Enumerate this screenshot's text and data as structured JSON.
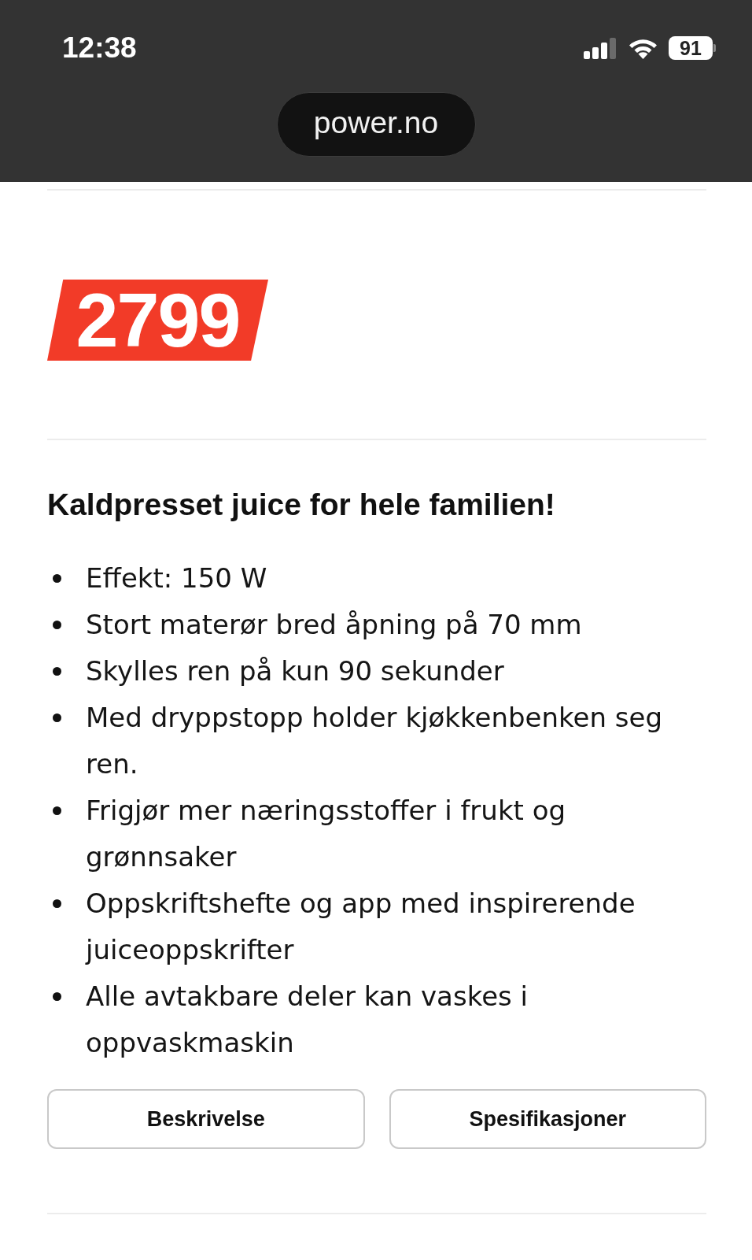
{
  "status_bar": {
    "time": "12:38",
    "battery": "91"
  },
  "browser": {
    "url": "power.no"
  },
  "product": {
    "price": "2799",
    "heading": "Kaldpresset juice for hele familien!",
    "features": [
      "Effekt: 150 W",
      "Stort materør bred åpning på 70 mm",
      "Skylles ren på kun 90 sekunder",
      "Med dryppstopp holder kjøkkenbenken seg ren.",
      "Frigjør mer næringsstoffer i frukt og grønnsaker",
      "Oppskriftshefte og app med inspirerende juiceoppskrifter",
      "Alle avtakbare deler kan vaskes i oppvaskmaskin"
    ]
  },
  "buttons": [
    {
      "label": "Beskrivelse"
    },
    {
      "label": "Spesifikasjoner"
    }
  ]
}
